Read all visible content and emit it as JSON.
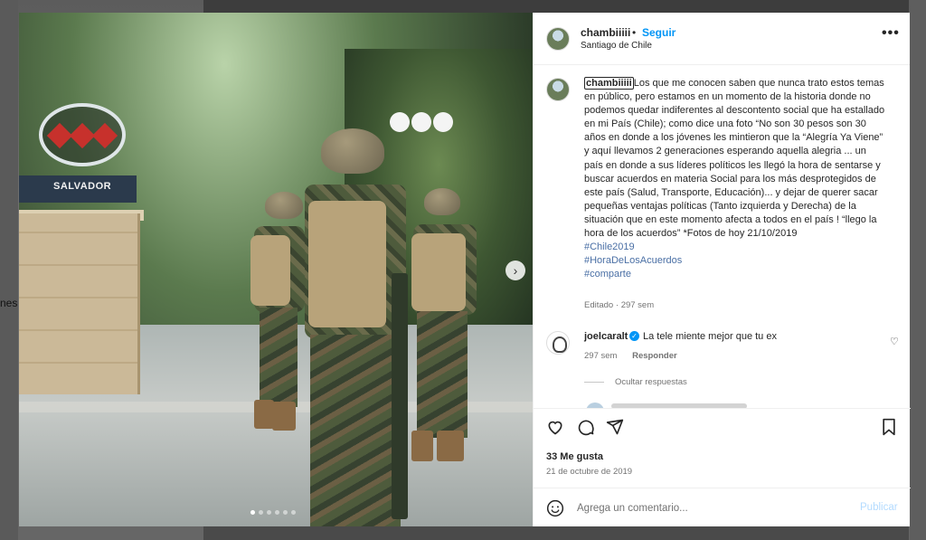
{
  "background": {
    "left_fragment": "nes"
  },
  "post": {
    "author": "chambiiiii",
    "follow_label": "Seguir",
    "separator": "•",
    "location": "Santiago de Chile",
    "more_icon": "more-horizontal-icon"
  },
  "photo": {
    "station_name": "SALVADOR",
    "next_icon": "chevron-right-icon",
    "slide_count": 6,
    "active_slide": 1
  },
  "caption": {
    "user": "chambiiiii",
    "text": "Los que me conocen saben que nunca trato estos temas en público, pero estamos en un momento de la historia donde no podemos quedar indiferentes al descontento social que ha estallado en mi País (Chile); como dice una foto “No son 30 pesos son 30 años en donde a los jóvenes les mintieron que la “Alegría Ya Viene” y aquí llevamos 2 generaciones esperando aquella alegria ... un país en donde a sus líderes políticos les llegó la hora de sentarse y buscar acuerdos en materia Social para los más desprotegidos de este país (Salud, Transporte, Educación)... y dejar de querer sacar pequeñas ventajas políticas (Tanto izquierda y Derecha) de la situación que en este momento afecta a todos en el país ! “llego la hora de los acuerdos” *Fotos de hoy 21/10/2019",
    "hashtags": [
      "#Chile2019",
      "#HoraDeLosAcuerdos",
      "#comparte"
    ],
    "edited": "Editado",
    "meta_sep": "·",
    "age": "297 sem"
  },
  "comment": {
    "user": "joelcaralt",
    "verified_icon": "verified-badge-icon",
    "text": "La tele miente mejor que tu ex",
    "age": "297 sem",
    "reply_label": "Responder",
    "heart_icon": "heart-outline-icon",
    "hide_replies": "Ocultar respuestas"
  },
  "actions": {
    "icons": [
      "heart-icon",
      "comment-icon",
      "share-icon",
      "bookmark-icon"
    ],
    "likes": "33 Me gusta",
    "date": "21 de octubre de 2019"
  },
  "composer": {
    "placeholder": "Agrega un comentario...",
    "publish_label": "Publicar",
    "emoji_icon": "emoji-icon"
  },
  "colors": {
    "accent": "#0095f6",
    "publish_disabled": "#b3dbff",
    "text_primary": "#262626",
    "text_secondary": "#737373"
  }
}
